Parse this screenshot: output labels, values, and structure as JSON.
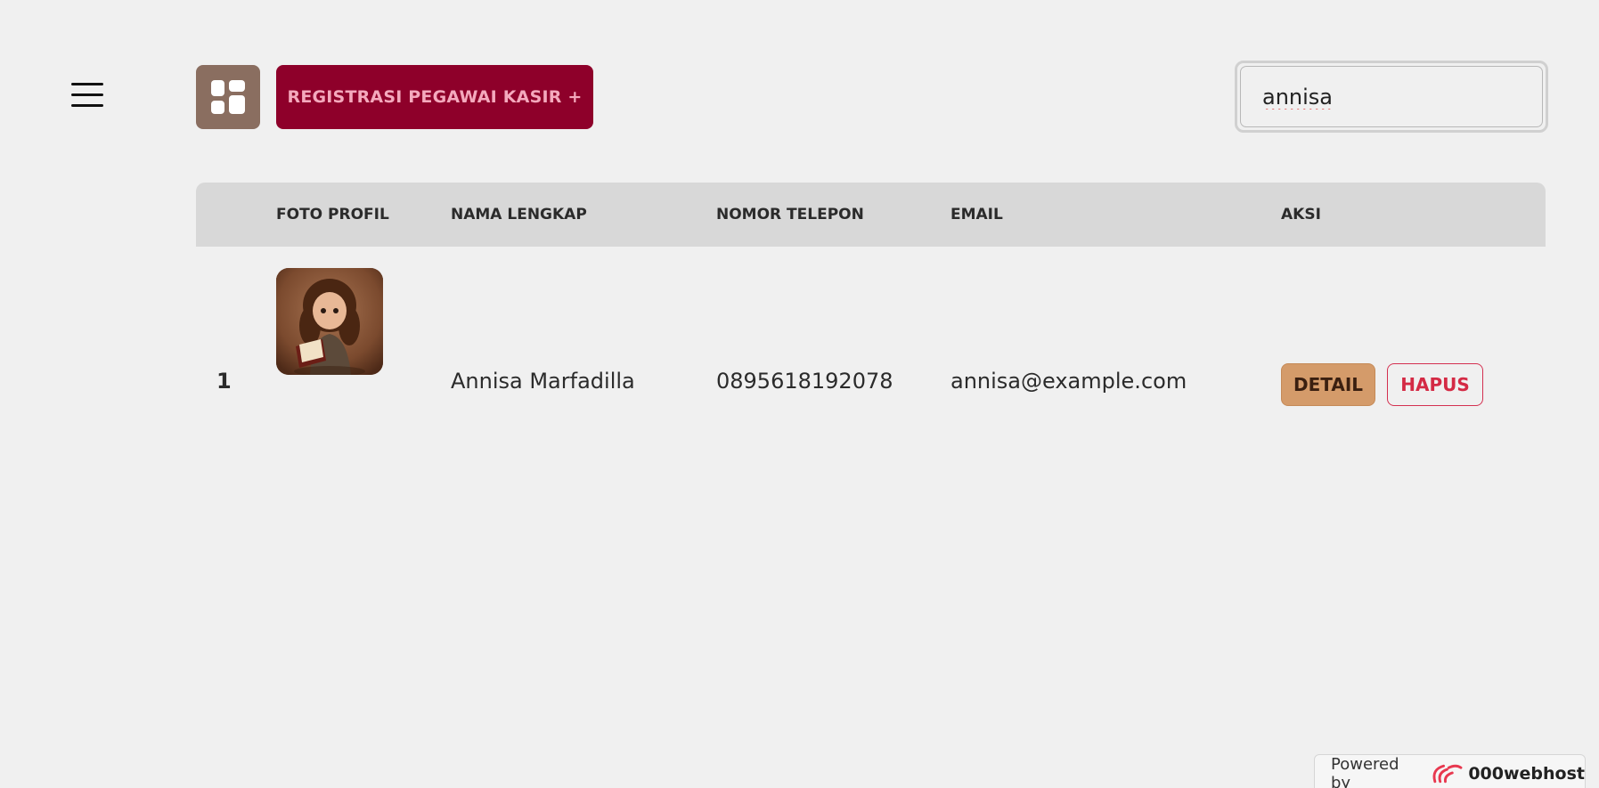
{
  "header": {
    "register_label": "REGISTRASI PEGAWAI KASIR +",
    "search_value": "annisa"
  },
  "icons": {
    "menu": "hamburger-menu-icon",
    "dashboard": "dashboard-grid-icon",
    "host_logo": "000webhost-logo-icon"
  },
  "table": {
    "columns": [
      "",
      "FOTO PROFIL",
      "NAMA LENGKAP",
      "NOMOR TELEPON",
      "EMAIL",
      "AKSI"
    ],
    "rows": [
      {
        "no": "1",
        "name": "Annisa Marfadilla",
        "phone": "0895618192078",
        "email": "annisa@example.com",
        "detail_label": "DETAIL",
        "delete_label": "HAPUS"
      }
    ]
  },
  "footer": {
    "powered_label": "Powered by",
    "brand": "000webhost"
  },
  "colors": {
    "background": "#f0f0f0",
    "primary": "#8e002a",
    "dashboard_button": "#8a6e60",
    "detail_button": "#d49b6a",
    "delete_border": "#d43050"
  }
}
